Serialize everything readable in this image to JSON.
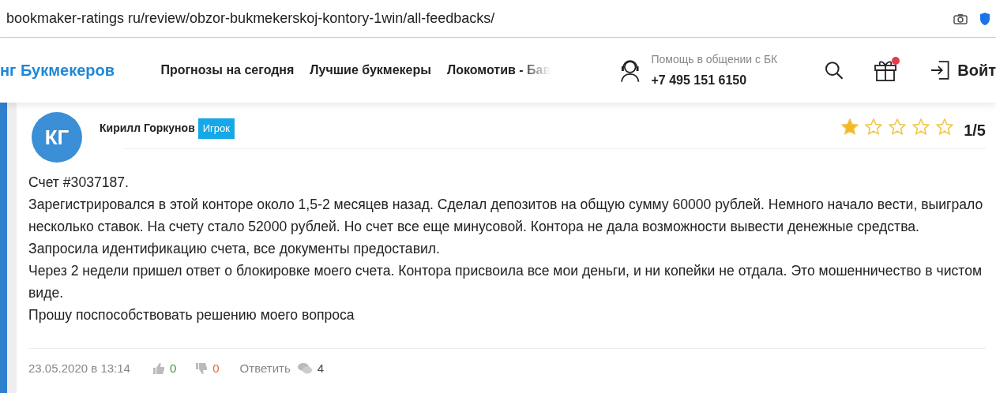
{
  "browser": {
    "url": "bookmaker-ratings ru/review/obzor-bukmekerskoj-kontory-1win/all-feedbacks/"
  },
  "header": {
    "logo": "нг Букмекеров",
    "nav": [
      "Прогнозы на сегодня",
      "Лучшие букмекеры",
      "Локомотив - Бав"
    ],
    "help_label": "Помощь в общении с БК",
    "phone": "+7 495 151 6150",
    "gift_badge": true,
    "login": "Войт"
  },
  "review": {
    "initials": "КГ",
    "author": "Кирилл Горкунов",
    "role": "Игрок",
    "stars": 1,
    "score": "1/5",
    "paragraphs": [
      "Счет #3037187.",
      "Зарегистрировался в этой конторе около 1,5-2 месяцев назад. Сделал депозитов на общую сумму 60000 рублей. Немного начало вести, выиграло несколько ставок. На счету стало 52000 рублей. Но счет все еще минусовой. Контора не дала возможности вывести денежные средства. Запросила идентификацию счета, все документы предоставил.",
      "Через 2 недели пришел ответ о блокировке моего счета. Контора присвоила все мои деньги, и ни копейки не отдала. Это мошенничество в чистом виде.",
      "Прошу поспособствовать решению моего вопроса"
    ],
    "date": "23.05.2020 в 13:14",
    "likes": "0",
    "dislikes": "0",
    "reply": "Ответить",
    "comments": "4"
  }
}
